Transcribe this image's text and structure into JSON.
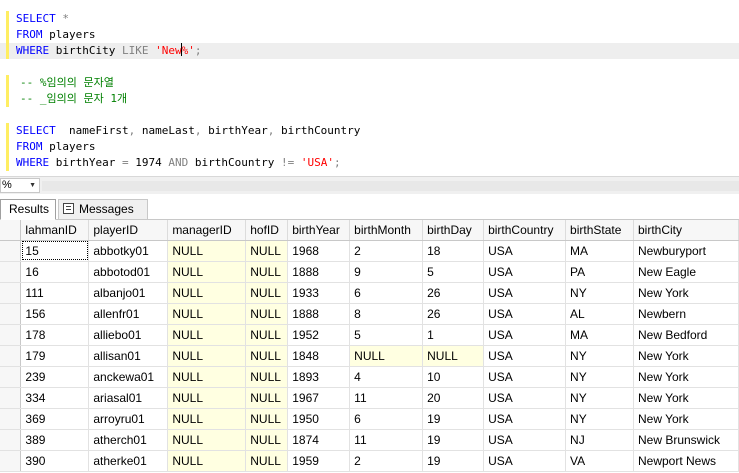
{
  "editor": {
    "lines": [
      {
        "tokens": [
          {
            "t": "SELECT",
            "c": "kw"
          },
          {
            "t": " "
          },
          {
            "t": "*",
            "c": "gr"
          }
        ]
      },
      {
        "tokens": [
          {
            "t": "FROM",
            "c": "kw"
          },
          {
            "t": " players"
          }
        ]
      },
      {
        "highlight": true,
        "tokens": [
          {
            "t": "WHERE",
            "c": "kw"
          },
          {
            "t": " birthCity "
          },
          {
            "t": "LIKE",
            "c": "gr"
          },
          {
            "t": " "
          },
          {
            "t": "'New",
            "c": "str"
          },
          {
            "caret": true
          },
          {
            "t": "%'",
            "c": "str"
          },
          {
            "t": ";",
            "c": "gr"
          }
        ]
      },
      {
        "tokens": []
      },
      {
        "comment": true,
        "tokens": [
          {
            "t": "-- %임의의 문자열",
            "c": "cm"
          }
        ]
      },
      {
        "comment": true,
        "tokens": [
          {
            "t": "-- _임의의 문자 1개",
            "c": "cm"
          }
        ]
      },
      {
        "tokens": []
      },
      {
        "tokens": [
          {
            "t": "SELECT",
            "c": "kw"
          },
          {
            "t": "  nameFirst"
          },
          {
            "t": ",",
            "c": "gr"
          },
          {
            "t": " nameLast"
          },
          {
            "t": ",",
            "c": "gr"
          },
          {
            "t": " birthYear"
          },
          {
            "t": ",",
            "c": "gr"
          },
          {
            "t": " birthCountry"
          }
        ]
      },
      {
        "tokens": [
          {
            "t": "FROM",
            "c": "kw"
          },
          {
            "t": " players"
          }
        ]
      },
      {
        "tokens": [
          {
            "t": "WHERE",
            "c": "kw"
          },
          {
            "t": " birthYear "
          },
          {
            "t": "=",
            "c": "gr"
          },
          {
            "t": " 1974 "
          },
          {
            "t": "AND",
            "c": "gr"
          },
          {
            "t": " birthCountry "
          },
          {
            "t": "!=",
            "c": "gr"
          },
          {
            "t": " "
          },
          {
            "t": "'USA'",
            "c": "str"
          },
          {
            "t": ";",
            "c": "gr"
          }
        ]
      }
    ]
  },
  "zoom": {
    "value": "%"
  },
  "tabs": {
    "results": "Results",
    "messages": "Messages"
  },
  "grid": {
    "columns": [
      "lahmanID",
      "playerID",
      "managerID",
      "hofID",
      "birthYear",
      "birthMonth",
      "birthDay",
      "birthCountry",
      "birthState",
      "birthCity"
    ],
    "rows": [
      [
        "15",
        "abbotky01",
        "NULL",
        "NULL",
        "1968",
        "2",
        "18",
        "USA",
        "MA",
        "Newburyport"
      ],
      [
        "16",
        "abbotod01",
        "NULL",
        "NULL",
        "1888",
        "9",
        "5",
        "USA",
        "PA",
        "New Eagle"
      ],
      [
        "111",
        "albanjo01",
        "NULL",
        "NULL",
        "1933",
        "6",
        "26",
        "USA",
        "NY",
        "New York"
      ],
      [
        "156",
        "allenfr01",
        "NULL",
        "NULL",
        "1888",
        "8",
        "26",
        "USA",
        "AL",
        "Newbern"
      ],
      [
        "178",
        "alliebo01",
        "NULL",
        "NULL",
        "1952",
        "5",
        "1",
        "USA",
        "MA",
        "New Bedford"
      ],
      [
        "179",
        "allisan01",
        "NULL",
        "NULL",
        "1848",
        "NULL",
        "NULL",
        "USA",
        "NY",
        "New York"
      ],
      [
        "239",
        "anckewa01",
        "NULL",
        "NULL",
        "1893",
        "4",
        "10",
        "USA",
        "NY",
        "New York"
      ],
      [
        "334",
        "ariasal01",
        "NULL",
        "NULL",
        "1967",
        "11",
        "20",
        "USA",
        "NY",
        "New York"
      ],
      [
        "369",
        "arroyru01",
        "NULL",
        "NULL",
        "1950",
        "6",
        "19",
        "USA",
        "NY",
        "New York"
      ],
      [
        "389",
        "atherch01",
        "NULL",
        "NULL",
        "1874",
        "11",
        "19",
        "USA",
        "NJ",
        "New Brunswick"
      ],
      [
        "390",
        "atherke01",
        "NULL",
        "NULL",
        "1959",
        "2",
        "19",
        "USA",
        "VA",
        "Newport News"
      ]
    ],
    "selected_cell": [
      0,
      0
    ]
  }
}
